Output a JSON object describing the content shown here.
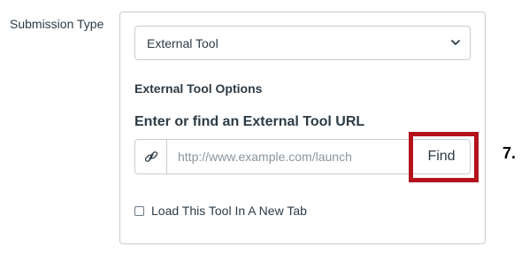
{
  "form": {
    "submission_type_label": "Submission Type",
    "submission_type_value": "External Tool",
    "options_heading": "External Tool Options",
    "url_label": "Enter or find an External Tool URL",
    "url_placeholder": "http://www.example.com/launch",
    "url_value": "",
    "find_button_label": "Find",
    "new_tab_label": "Load This Tool In A New Tab",
    "new_tab_checked": false
  },
  "annotation": {
    "step_marker": "7.",
    "highlight_color": "#b3121d"
  },
  "icons": {
    "select_chevron": "chevron-down-icon",
    "url_addon": "link-icon"
  }
}
